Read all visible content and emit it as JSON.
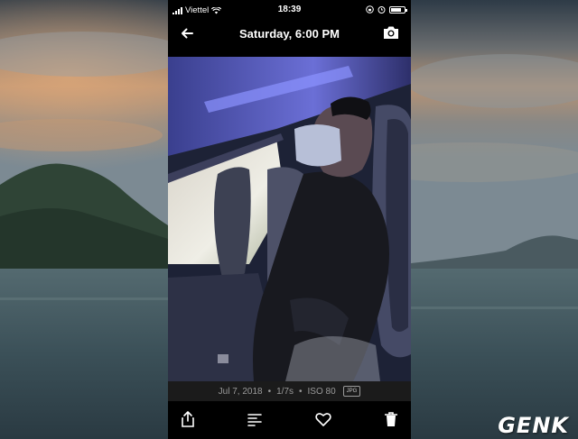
{
  "status_bar": {
    "carrier": "Viettel",
    "time": "18:39"
  },
  "nav": {
    "title": "Saturday, 6:00 PM"
  },
  "photo_meta": {
    "date": "Jul 7, 2018",
    "shutter": "1/7s",
    "iso": "ISO 80",
    "format": "JPG"
  },
  "toolbar": {
    "items": [
      "share-icon",
      "details-icon",
      "favorite-icon",
      "delete-icon"
    ]
  },
  "watermark": {
    "text": "GENK"
  },
  "colors": {
    "app_background": "#000000",
    "meta_text": "#9a9a9a",
    "meta_background": "#1b1b1b",
    "watermark_accent": "#e31b23"
  }
}
